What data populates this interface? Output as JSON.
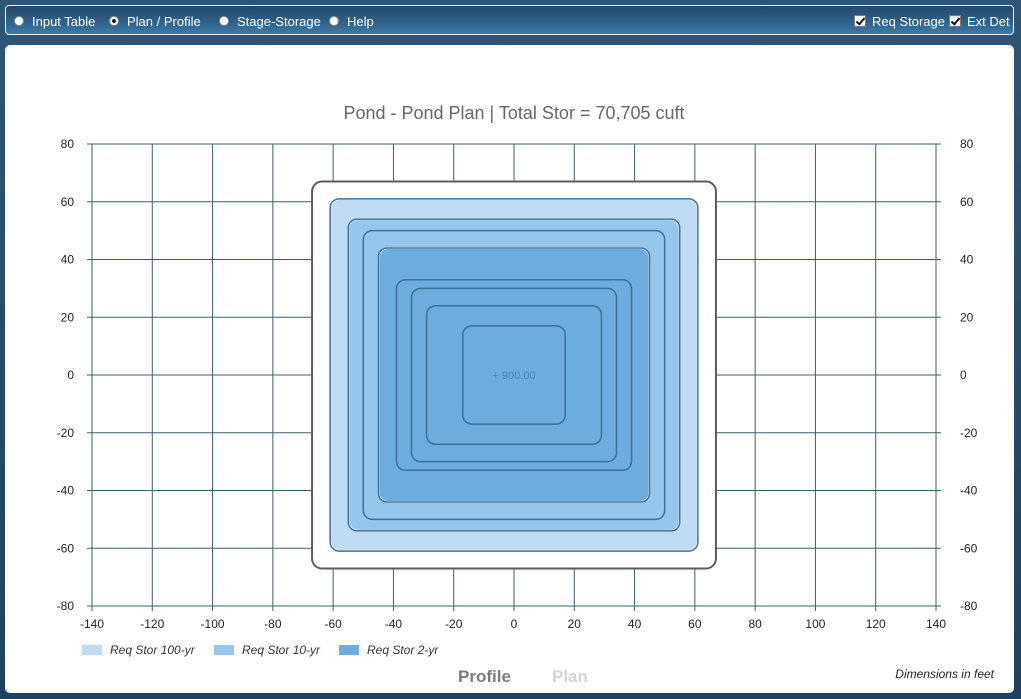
{
  "toolbar": {
    "tabs": [
      {
        "label": "Input Table",
        "selected": false
      },
      {
        "label": "Plan / Profile",
        "selected": true
      },
      {
        "label": "Stage-Storage",
        "selected": false
      },
      {
        "label": "Help",
        "selected": false
      }
    ],
    "checkboxes": [
      {
        "label": "Req Storage",
        "checked": true
      },
      {
        "label": "Ext Det",
        "checked": true
      }
    ]
  },
  "chart_data": {
    "type": "plan",
    "title": "Pond - Pond Plan | Total Stor = 70,705 cuft",
    "xlim": [
      -140,
      140
    ],
    "ylim": [
      -80,
      80
    ],
    "x_ticks": [
      -140,
      -120,
      -100,
      -80,
      -60,
      -40,
      -20,
      0,
      20,
      40,
      60,
      80,
      100,
      120,
      140
    ],
    "y_ticks": [
      80,
      60,
      40,
      20,
      0,
      -20,
      -40,
      -60,
      -80
    ],
    "grid": true,
    "outer_rim": {
      "x": [
        -67,
        67
      ],
      "y": [
        -67,
        67
      ]
    },
    "fills": [
      {
        "name": "Req Stor 100-yr",
        "x": [
          -61,
          61
        ],
        "y": [
          -61,
          61
        ],
        "color": "#c0dcf4"
      },
      {
        "name": "Req Stor 10-yr",
        "x": [
          -55,
          55
        ],
        "y": [
          -54,
          54
        ],
        "color": "#96c6ec"
      },
      {
        "name": "Req Stor 2-yr",
        "x": [
          -45,
          45
        ],
        "y": [
          -44,
          44
        ],
        "color": "#6dacde"
      }
    ],
    "contours": [
      {
        "x": [
          -61,
          61
        ],
        "y": [
          -61,
          61
        ]
      },
      {
        "x": [
          -55,
          55
        ],
        "y": [
          -54,
          54
        ]
      },
      {
        "x": [
          -50,
          50
        ],
        "y": [
          -50,
          50
        ]
      },
      {
        "x": [
          -45,
          45
        ],
        "y": [
          -44,
          44
        ]
      },
      {
        "x": [
          -39,
          39
        ],
        "y": [
          -33,
          33
        ]
      },
      {
        "x": [
          -34,
          34
        ],
        "y": [
          -30,
          30
        ]
      },
      {
        "x": [
          -29,
          29
        ],
        "y": [
          -24,
          24
        ]
      },
      {
        "x": [
          -17,
          17
        ],
        "y": [
          -17,
          17
        ]
      }
    ],
    "spot_label": "+ 900.00",
    "legend": [
      {
        "name": "Req Stor 100-yr",
        "color": "#c0dcf4"
      },
      {
        "name": "Req Stor 10-yr",
        "color": "#96c6ec"
      },
      {
        "name": "Req Stor 2-yr",
        "color": "#6dacde"
      }
    ]
  },
  "view_tabs": [
    {
      "label": "Profile",
      "active": true
    },
    {
      "label": "Plan",
      "active": false
    }
  ],
  "footnote": "Dimensions in feet"
}
